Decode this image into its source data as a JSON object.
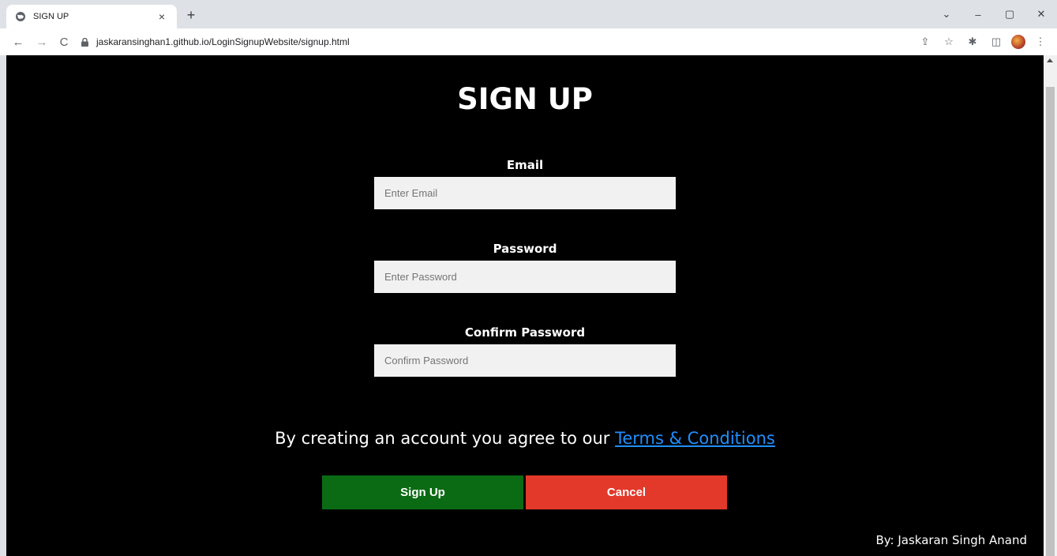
{
  "browser": {
    "tab_title": "SIGN UP",
    "tab_close": "×",
    "new_tab": "+",
    "url": "jaskaransinghan1.github.io/LoginSignupWebsite/signup.html",
    "window_controls": [
      "⌄",
      "–",
      "▢",
      "✕"
    ]
  },
  "page": {
    "title": "SIGN UP",
    "fields": [
      {
        "label": "Email",
        "placeholder": "Enter Email"
      },
      {
        "label": "Password",
        "placeholder": "Enter Password"
      },
      {
        "label": "Confirm Password",
        "placeholder": "Confirm Password"
      }
    ],
    "terms_text": "By creating an account you agree to our ",
    "terms_link": "Terms & Conditions",
    "signup_label": "Sign Up",
    "cancel_label": "Cancel",
    "footer": "By: Jaskaran Singh Anand"
  },
  "colors": {
    "background": "#000000",
    "signup": "#0b6b14",
    "cancel": "#e2392b",
    "link": "#1f8fff"
  }
}
